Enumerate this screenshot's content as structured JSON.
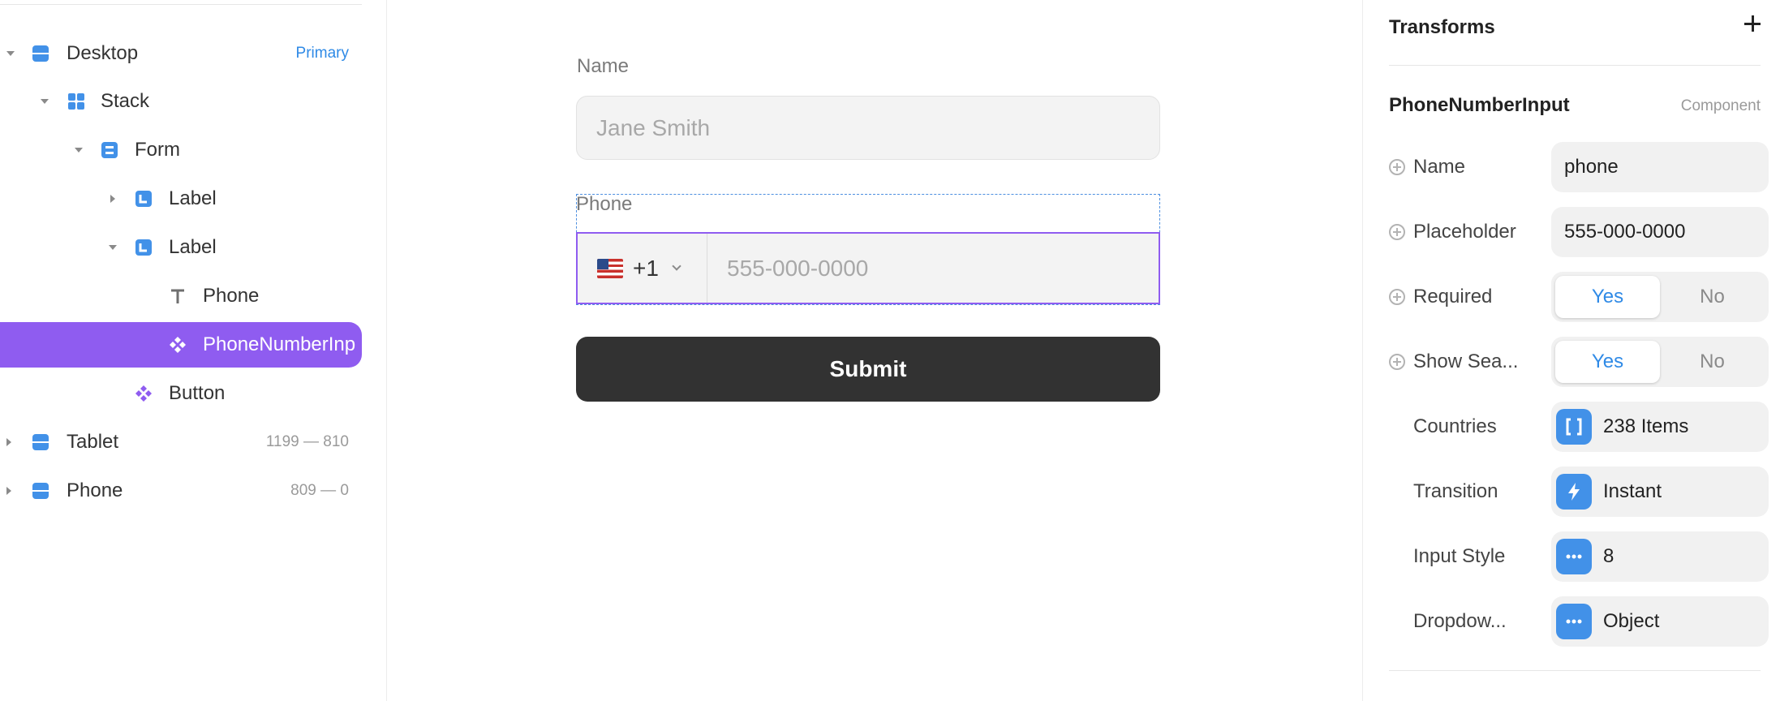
{
  "layers": {
    "items": [
      {
        "name": "Desktop",
        "meta": "Primary",
        "icon": "stack-icon",
        "expanded": true
      },
      {
        "name": "Stack",
        "meta": "",
        "icon": "grid-icon",
        "expanded": true
      },
      {
        "name": "Form",
        "meta": "",
        "icon": "stack-icon",
        "expanded": true
      },
      {
        "name": "Label",
        "meta": "",
        "icon": "label-icon",
        "expanded": false
      },
      {
        "name": "Label",
        "meta": "",
        "icon": "label-icon",
        "expanded": true
      },
      {
        "name": "Phone",
        "meta": "",
        "icon": "text-icon"
      },
      {
        "name": "PhoneNumberInp",
        "meta": "",
        "icon": "component-icon",
        "selected": true
      },
      {
        "name": "Button",
        "meta": "",
        "icon": "component-icon"
      },
      {
        "name": "Tablet",
        "meta": "1199 — 810",
        "icon": "stack-icon",
        "expanded": false
      },
      {
        "name": "Phone",
        "meta": "809 — 0",
        "icon": "stack-icon",
        "expanded": false
      }
    ]
  },
  "canvas": {
    "name_label": "Name",
    "name_placeholder": "Jane Smith",
    "phone_label": "Phone",
    "country_code": "+1",
    "country_flag": "us-flag-icon",
    "phone_placeholder": "555-000-0000",
    "submit_label": "Submit"
  },
  "props": {
    "section_title": "Transforms",
    "component_name": "PhoneNumberInput",
    "component_type": "Component",
    "rows": [
      {
        "label": "Name",
        "value": "phone"
      },
      {
        "label": "Placeholder",
        "value": "555-000-0000"
      },
      {
        "label": "Required",
        "yes": "Yes",
        "no": "No",
        "selected": "Yes"
      },
      {
        "label": "Show Sea...",
        "yes": "Yes",
        "no": "No",
        "selected": "Yes"
      },
      {
        "label": "Countries",
        "value": "238 Items",
        "icon": "array-icon"
      },
      {
        "label": "Transition",
        "value": "Instant",
        "icon": "lightning-icon"
      },
      {
        "label": "Input Style",
        "value": "8",
        "icon": "more-icon"
      },
      {
        "label": "Dropdow...",
        "value": "Object",
        "icon": "more-icon"
      }
    ]
  },
  "colors": {
    "accent": "#8f5cf0",
    "blue": "#2f8ae6",
    "icon_blue": "#4291e8",
    "button_dark": "#323232"
  }
}
